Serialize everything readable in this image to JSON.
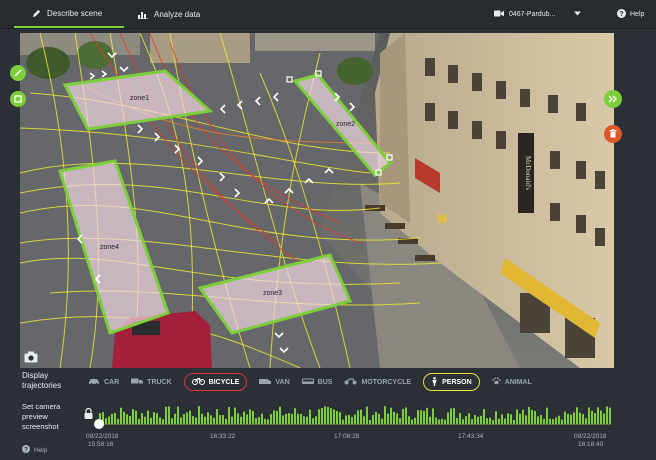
{
  "tabs": [
    {
      "label": "Describe scene",
      "icon": "pencil-icon",
      "active": true
    },
    {
      "label": "Analyze data",
      "icon": "bar-chart-icon",
      "active": false
    }
  ],
  "camera": {
    "name": "0467-Pardub..."
  },
  "help": {
    "label": "Help"
  },
  "zones": [
    {
      "label": "zone1"
    },
    {
      "label": "zone2"
    },
    {
      "label": "zone4"
    },
    {
      "label": "zone3"
    }
  ],
  "filters": {
    "label": "Display trajectories",
    "items": [
      {
        "label": "CAR",
        "icon": "car-icon",
        "selected": false
      },
      {
        "label": "TRUCK",
        "icon": "truck-icon",
        "selected": false
      },
      {
        "label": "BICYCLE",
        "icon": "bicycle-icon",
        "selected": true,
        "highlight": "#d8353a"
      },
      {
        "label": "VAN",
        "icon": "van-icon",
        "selected": false
      },
      {
        "label": "BUS",
        "icon": "bus-icon",
        "selected": false
      },
      {
        "label": "MOTORCYCLE",
        "icon": "motorcycle-icon",
        "selected": false
      },
      {
        "label": "PERSON",
        "icon": "person-icon",
        "selected": true,
        "highlight": "#e7e13b"
      },
      {
        "label": "ANIMAL",
        "icon": "paw-icon",
        "selected": false
      }
    ]
  },
  "preview": {
    "label": "Set camera preview screenshot",
    "timeline": {
      "start_date": "08/22/2018",
      "start_time": "15:58:16",
      "tick1": "16:33:22",
      "tick2": "17:08:28",
      "tick3": "17:43:34",
      "end_date": "08/22/2018",
      "end_time": "18:18:40"
    }
  },
  "help_bottom": {
    "label": "Help"
  },
  "colors": {
    "accent": "#7ccf3a",
    "delete": "#e0552a",
    "person": "#e7e13b",
    "bicycle": "#d8353a"
  }
}
